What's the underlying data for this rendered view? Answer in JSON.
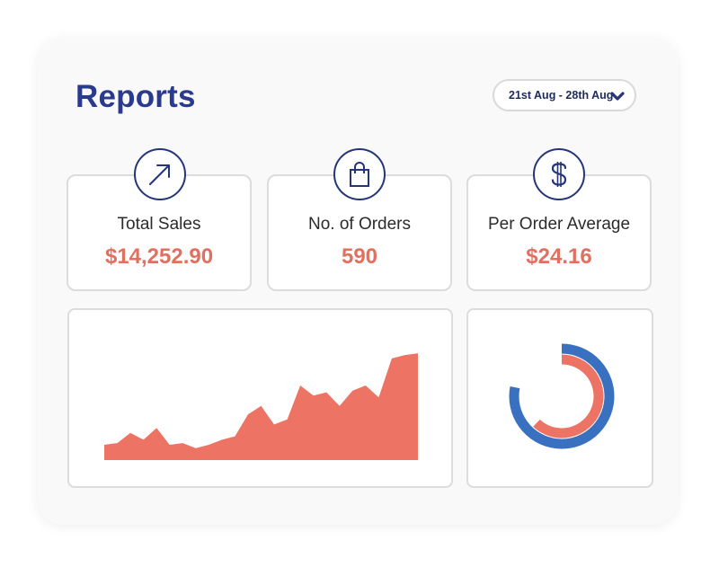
{
  "header": {
    "title": "Reports"
  },
  "date_range": {
    "label": "21st Aug - 28th Aug",
    "icon": "chevron-down-icon"
  },
  "stats": [
    {
      "label": "Total Sales",
      "value": "$14,252.90",
      "icon": "arrow-up-right-icon"
    },
    {
      "label": "No. of Orders",
      "value": "590",
      "icon": "shopping-bag-icon"
    },
    {
      "label": "Per Order Average",
      "value": "$24.16",
      "icon": "dollar-icon"
    }
  ],
  "colors": {
    "title": "#2a3a8c",
    "accent_value": "#e07060",
    "area_fill": "#ed7364",
    "donut_outer": "#3a70c0",
    "donut_inner": "#ed7364",
    "icon_stroke": "#263579"
  },
  "chart_data": [
    {
      "type": "area",
      "title": "",
      "xlabel": "",
      "ylabel": "",
      "grid": false,
      "x": [
        1,
        2,
        3,
        4,
        5,
        6,
        7,
        8,
        9,
        10,
        11,
        12,
        13,
        14,
        15,
        16,
        17,
        18,
        19,
        20,
        21,
        22,
        23,
        24,
        25
      ],
      "values": [
        9,
        10,
        16,
        12,
        19,
        9,
        10,
        7,
        9,
        12,
        14,
        27,
        32,
        21,
        24,
        44,
        38,
        40,
        32,
        41,
        44,
        37,
        60,
        62,
        63
      ],
      "ylim": [
        0,
        70
      ]
    },
    {
      "type": "pie",
      "style": "donut-rings",
      "title": "",
      "series": [
        {
          "ring": "outer",
          "value": 0.78,
          "color": "#3a70c0"
        },
        {
          "ring": "inner",
          "value": 0.62,
          "color": "#ed7364"
        }
      ]
    }
  ]
}
